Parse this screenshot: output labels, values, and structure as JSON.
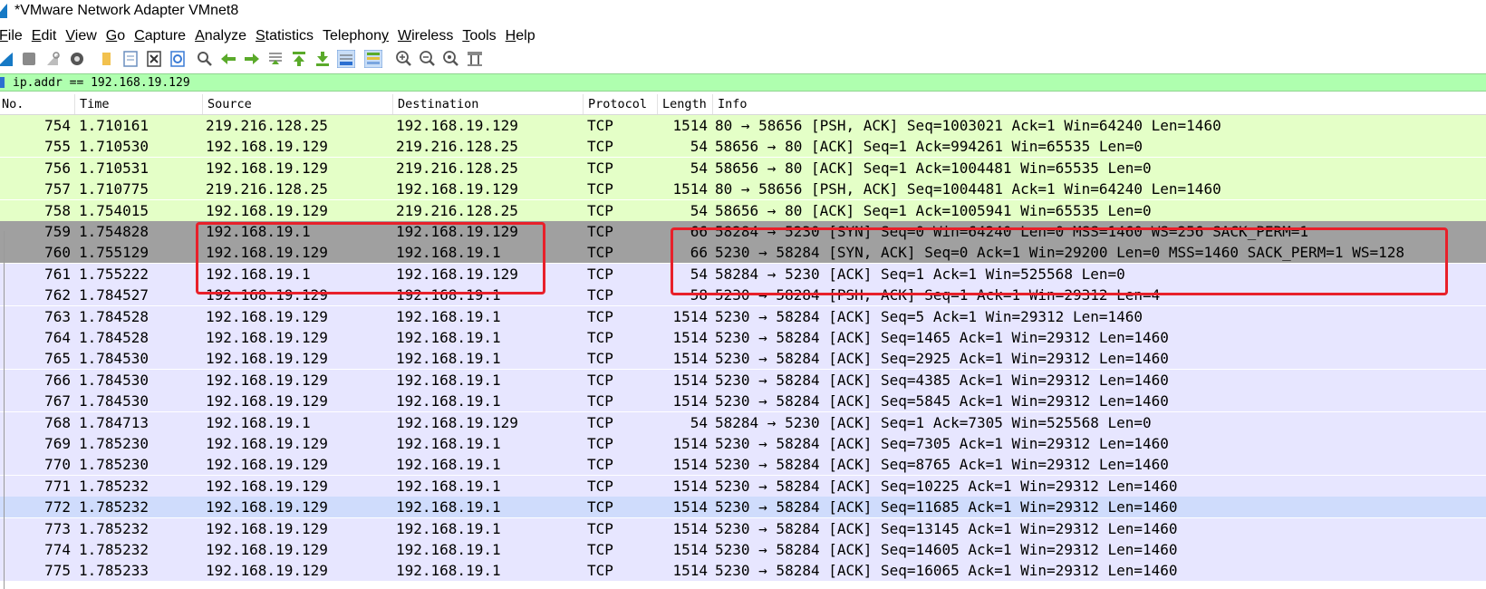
{
  "window": {
    "title": "*VMware Network Adapter VMnet8"
  },
  "menu": {
    "items": [
      {
        "label": "File",
        "key": "F"
      },
      {
        "label": "Edit",
        "key": "E"
      },
      {
        "label": "View",
        "key": "V"
      },
      {
        "label": "Go",
        "key": "G"
      },
      {
        "label": "Capture",
        "key": "C"
      },
      {
        "label": "Analyze",
        "key": "A"
      },
      {
        "label": "Statistics",
        "key": "S"
      },
      {
        "label": "Telephony",
        "key": "y"
      },
      {
        "label": "Wireless",
        "key": "W"
      },
      {
        "label": "Tools",
        "key": "T"
      },
      {
        "label": "Help",
        "key": "H"
      }
    ]
  },
  "toolbar": {
    "icons": [
      "start-capture-icon",
      "stop-capture-icon",
      "restart-capture-icon",
      "capture-options-icon",
      "open-file-icon",
      "save-file-icon",
      "close-file-icon",
      "reload-file-icon",
      "find-packet-icon",
      "go-back-icon",
      "go-forward-icon",
      "go-to-packet-icon",
      "go-first-packet-icon",
      "go-last-packet-icon",
      "auto-scroll-icon",
      "colorize-icon",
      "zoom-in-icon",
      "zoom-out-icon",
      "normal-size-icon",
      "resize-columns-icon"
    ]
  },
  "filter": {
    "value": "ip.addr == 192.168.19.129"
  },
  "columns": {
    "no": "No.",
    "time": "Time",
    "source": "Source",
    "destination": "Destination",
    "protocol": "Protocol",
    "length": "Length",
    "info": "Info"
  },
  "colors": {
    "tcp_green": "#e4ffc7",
    "tcp_lavender": "#e7e6ff",
    "selected_dark": "#a0a0a0",
    "selected_light": "#cfdcfc",
    "filter_valid": "#afffaf",
    "annotation_red": "#e8202a"
  },
  "packets": [
    {
      "no": "754",
      "time": "1.710161",
      "src": "219.216.128.25",
      "dst": "192.168.19.129",
      "proto": "TCP",
      "len": "1514",
      "info": "80 → 58656 [PSH, ACK] Seq=1003021 Ack=1 Win=64240 Len=1460",
      "style": "green"
    },
    {
      "no": "755",
      "time": "1.710530",
      "src": "192.168.19.129",
      "dst": "219.216.128.25",
      "proto": "TCP",
      "len": "54",
      "info": "58656 → 80 [ACK] Seq=1 Ack=994261 Win=65535 Len=0",
      "style": "green"
    },
    {
      "no": "756",
      "time": "1.710531",
      "src": "192.168.19.129",
      "dst": "219.216.128.25",
      "proto": "TCP",
      "len": "54",
      "info": "58656 → 80 [ACK] Seq=1 Ack=1004481 Win=65535 Len=0",
      "style": "green"
    },
    {
      "no": "757",
      "time": "1.710775",
      "src": "219.216.128.25",
      "dst": "192.168.19.129",
      "proto": "TCP",
      "len": "1514",
      "info": "80 → 58656 [PSH, ACK] Seq=1004481 Ack=1 Win=64240 Len=1460",
      "style": "green"
    },
    {
      "no": "758",
      "time": "1.754015",
      "src": "192.168.19.129",
      "dst": "219.216.128.25",
      "proto": "TCP",
      "len": "54",
      "info": "58656 → 80 [ACK] Seq=1 Ack=1005941 Win=65535 Len=0",
      "style": "green"
    },
    {
      "no": "759",
      "time": "1.754828",
      "src": "192.168.19.1",
      "dst": "192.168.19.129",
      "proto": "TCP",
      "len": "66",
      "info": "58284 → 5230 [SYN] Seq=0 Win=64240 Len=0 MSS=1460 WS=256 SACK_PERM=1",
      "style": "dark"
    },
    {
      "no": "760",
      "time": "1.755129",
      "src": "192.168.19.129",
      "dst": "192.168.19.1",
      "proto": "TCP",
      "len": "66",
      "info": "5230 → 58284 [SYN, ACK] Seq=0 Ack=1 Win=29200 Len=0 MSS=1460 SACK_PERM=1 WS=128",
      "style": "dark"
    },
    {
      "no": "761",
      "time": "1.755222",
      "src": "192.168.19.1",
      "dst": "192.168.19.129",
      "proto": "TCP",
      "len": "54",
      "info": "58284 → 5230 [ACK] Seq=1 Ack=1 Win=525568 Len=0",
      "style": "lavender"
    },
    {
      "no": "762",
      "time": "1.784527",
      "src": "192.168.19.129",
      "dst": "192.168.19.1",
      "proto": "TCP",
      "len": "58",
      "info": "5230 → 58284 [PSH, ACK] Seq=1 Ack=1 Win=29312 Len=4",
      "style": "lavender"
    },
    {
      "no": "763",
      "time": "1.784528",
      "src": "192.168.19.129",
      "dst": "192.168.19.1",
      "proto": "TCP",
      "len": "1514",
      "info": "5230 → 58284 [ACK] Seq=5 Ack=1 Win=29312 Len=1460",
      "style": "lavender"
    },
    {
      "no": "764",
      "time": "1.784528",
      "src": "192.168.19.129",
      "dst": "192.168.19.1",
      "proto": "TCP",
      "len": "1514",
      "info": "5230 → 58284 [ACK] Seq=1465 Ack=1 Win=29312 Len=1460",
      "style": "lavender"
    },
    {
      "no": "765",
      "time": "1.784530",
      "src": "192.168.19.129",
      "dst": "192.168.19.1",
      "proto": "TCP",
      "len": "1514",
      "info": "5230 → 58284 [ACK] Seq=2925 Ack=1 Win=29312 Len=1460",
      "style": "lavender"
    },
    {
      "no": "766",
      "time": "1.784530",
      "src": "192.168.19.129",
      "dst": "192.168.19.1",
      "proto": "TCP",
      "len": "1514",
      "info": "5230 → 58284 [ACK] Seq=4385 Ack=1 Win=29312 Len=1460",
      "style": "lavender"
    },
    {
      "no": "767",
      "time": "1.784530",
      "src": "192.168.19.129",
      "dst": "192.168.19.1",
      "proto": "TCP",
      "len": "1514",
      "info": "5230 → 58284 [ACK] Seq=5845 Ack=1 Win=29312 Len=1460",
      "style": "lavender"
    },
    {
      "no": "768",
      "time": "1.784713",
      "src": "192.168.19.1",
      "dst": "192.168.19.129",
      "proto": "TCP",
      "len": "54",
      "info": "58284 → 5230 [ACK] Seq=1 Ack=7305 Win=525568 Len=0",
      "style": "lavender"
    },
    {
      "no": "769",
      "time": "1.785230",
      "src": "192.168.19.129",
      "dst": "192.168.19.1",
      "proto": "TCP",
      "len": "1514",
      "info": "5230 → 58284 [ACK] Seq=7305 Ack=1 Win=29312 Len=1460",
      "style": "lavender"
    },
    {
      "no": "770",
      "time": "1.785230",
      "src": "192.168.19.129",
      "dst": "192.168.19.1",
      "proto": "TCP",
      "len": "1514",
      "info": "5230 → 58284 [ACK] Seq=8765 Ack=1 Win=29312 Len=1460",
      "style": "lavender"
    },
    {
      "no": "771",
      "time": "1.785232",
      "src": "192.168.19.129",
      "dst": "192.168.19.1",
      "proto": "TCP",
      "len": "1514",
      "info": "5230 → 58284 [ACK] Seq=10225 Ack=1 Win=29312 Len=1460",
      "style": "lavender"
    },
    {
      "no": "772",
      "time": "1.785232",
      "src": "192.168.19.129",
      "dst": "192.168.19.1",
      "proto": "TCP",
      "len": "1514",
      "info": "5230 → 58284 [ACK] Seq=11685 Ack=1 Win=29312 Len=1460",
      "style": "selected"
    },
    {
      "no": "773",
      "time": "1.785232",
      "src": "192.168.19.129",
      "dst": "192.168.19.1",
      "proto": "TCP",
      "len": "1514",
      "info": "5230 → 58284 [ACK] Seq=13145 Ack=1 Win=29312 Len=1460",
      "style": "lavender"
    },
    {
      "no": "774",
      "time": "1.785232",
      "src": "192.168.19.129",
      "dst": "192.168.19.1",
      "proto": "TCP",
      "len": "1514",
      "info": "5230 → 58284 [ACK] Seq=14605 Ack=1 Win=29312 Len=1460",
      "style": "lavender"
    },
    {
      "no": "775",
      "time": "1.785233",
      "src": "192.168.19.129",
      "dst": "192.168.19.1",
      "proto": "TCP",
      "len": "1514",
      "info": "5230 → 58284 [ACK] Seq=16065 Ack=1 Win=29312 Len=1460",
      "style": "lavender"
    }
  ]
}
